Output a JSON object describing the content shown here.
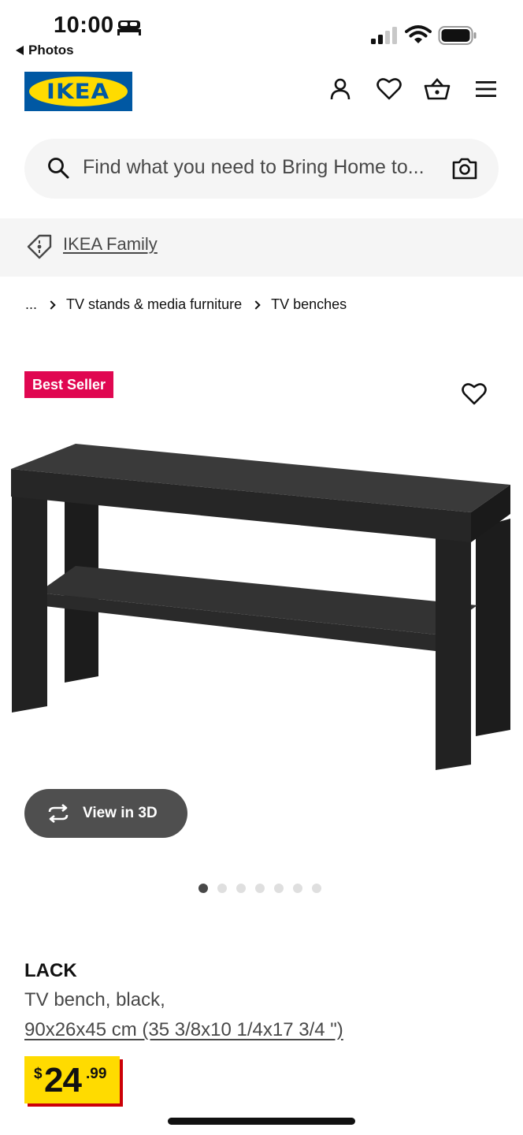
{
  "status_bar": {
    "time": "10:00",
    "back_label": "Photos"
  },
  "header": {
    "logo_text": "IKEA",
    "icons": [
      "account-icon",
      "heart-icon",
      "basket-icon",
      "menu-icon"
    ]
  },
  "search": {
    "placeholder": "Find what you need to Bring Home to..."
  },
  "family": {
    "link_label": "IKEA Family"
  },
  "breadcrumb": {
    "ellipsis": "...",
    "items": [
      "TV stands & media furniture",
      "TV benches"
    ]
  },
  "product": {
    "badge": "Best Seller",
    "view_3d_label": "View in 3D",
    "image_count": 7,
    "active_image": 1,
    "name": "LACK",
    "description": "TV bench, black,",
    "dimensions": "90x26x45 cm (35 3/8x10 1/4x17 3/4 \")",
    "price": {
      "currency": "$",
      "integer": "24",
      "decimal": ".99"
    }
  },
  "colors": {
    "ikea_blue": "#0058a3",
    "ikea_yellow": "#ffdb00",
    "badge_red": "#e00751",
    "price_shadow_red": "#cc0008"
  }
}
